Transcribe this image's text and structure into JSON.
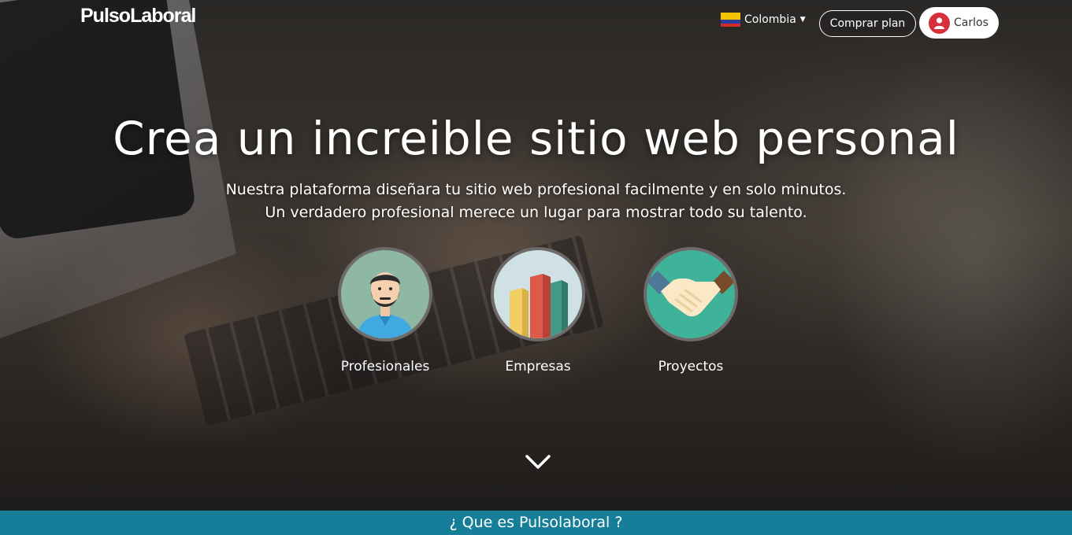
{
  "brand": {
    "logo_text": "PulsoLaboral"
  },
  "header": {
    "country_label": "Colombia",
    "buy_plan_label": "Comprar plan",
    "user_name": "Carlos"
  },
  "hero": {
    "title": "Crea un increible sitio web personal",
    "subtitle_line1": "Nuestra plataforma diseñara tu sitio web profesional facilmente y en solo minutos.",
    "subtitle_line2": "Un verdadero profesional merece un lugar para mostrar todo su talento."
  },
  "features": [
    {
      "label": "Profesionales",
      "icon": "professional-avatar-icon"
    },
    {
      "label": "Empresas",
      "icon": "buildings-chart-icon"
    },
    {
      "label": "Proyectos",
      "icon": "handshake-icon"
    }
  ],
  "footer_bar": {
    "title": "¿ Que es Pulsolaboral ?"
  },
  "colors": {
    "accent_bar": "#177e9a",
    "user_avatar": "#d7303d",
    "circle_pro_bg": "#8fb8a4",
    "circle_emp_bg": "#cfe1e4",
    "circle_proj_bg": "#3fb39a"
  }
}
